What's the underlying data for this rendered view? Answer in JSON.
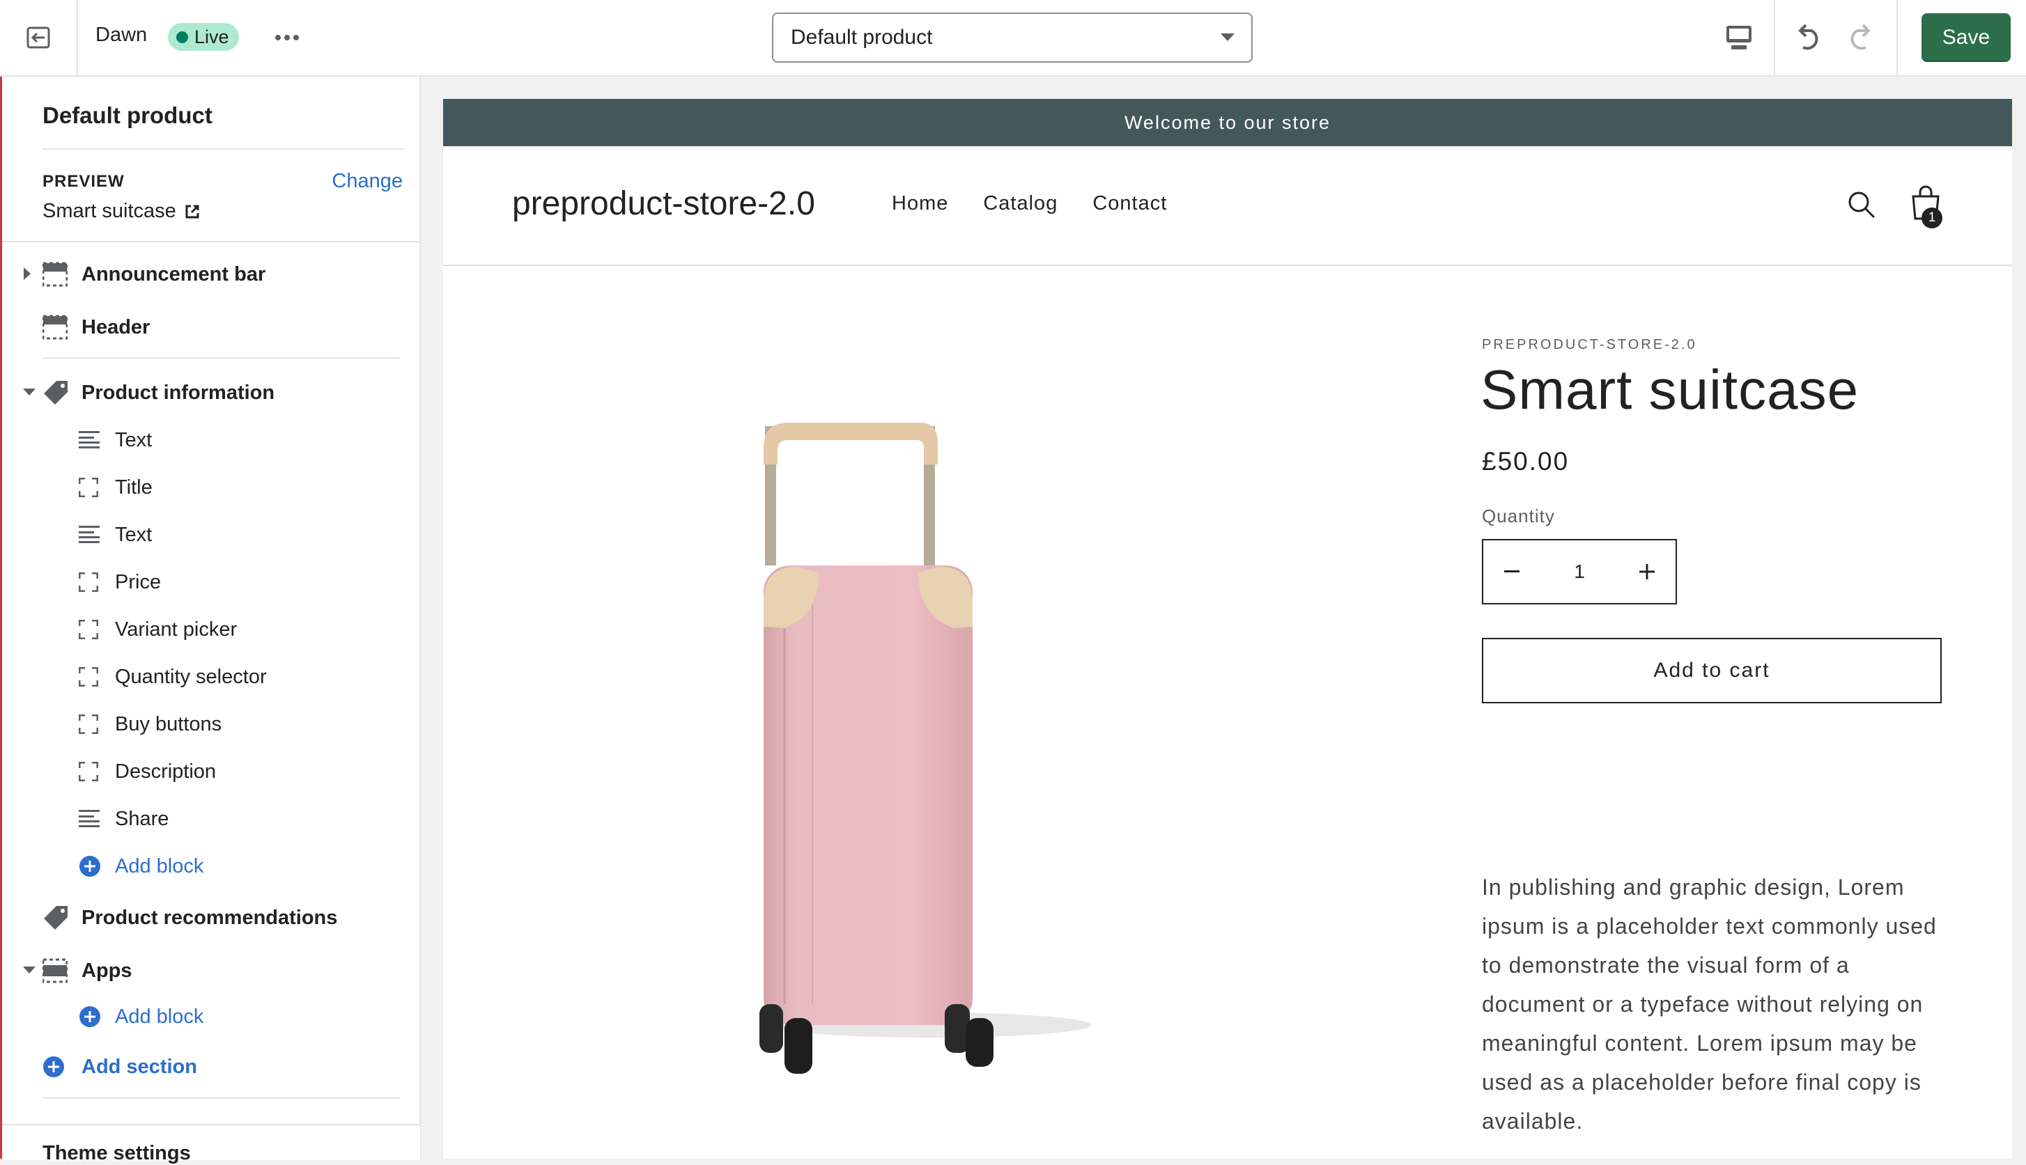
{
  "topbar": {
    "theme_name": "Dawn",
    "live_label": "Live",
    "template_select": "Default product",
    "save_label": "Save"
  },
  "sidebar": {
    "title": "Default product",
    "preview_label": "PREVIEW",
    "change_label": "Change",
    "preview_value": "Smart suitcase",
    "announcement_bar": "Announcement bar",
    "header": "Header",
    "product_information": "Product information",
    "blocks": [
      "Text",
      "Title",
      "Text",
      "Price",
      "Variant picker",
      "Quantity selector",
      "Buy buttons",
      "Description",
      "Share"
    ],
    "add_block": "Add block",
    "product_recommendations": "Product recommendations",
    "apps": "Apps",
    "add_section": "Add section",
    "theme_settings": "Theme settings"
  },
  "store": {
    "announcement": "Welcome to our store",
    "name": "preproduct-store-2.0",
    "nav": [
      "Home",
      "Catalog",
      "Contact"
    ],
    "cart_count": "1"
  },
  "product": {
    "vendor": "PREPRODUCT-STORE-2.0",
    "title": "Smart suitcase",
    "price": "£50.00",
    "quantity_label": "Quantity",
    "quantity": "1",
    "add_to_cart": "Add to cart",
    "description": "In publishing and graphic design, Lorem ipsum is a placeholder text commonly used to demonstrate the visual form of a document or a typeface without relying on meaningful content. Lorem ipsum may be used as a placeholder before final copy is available."
  }
}
